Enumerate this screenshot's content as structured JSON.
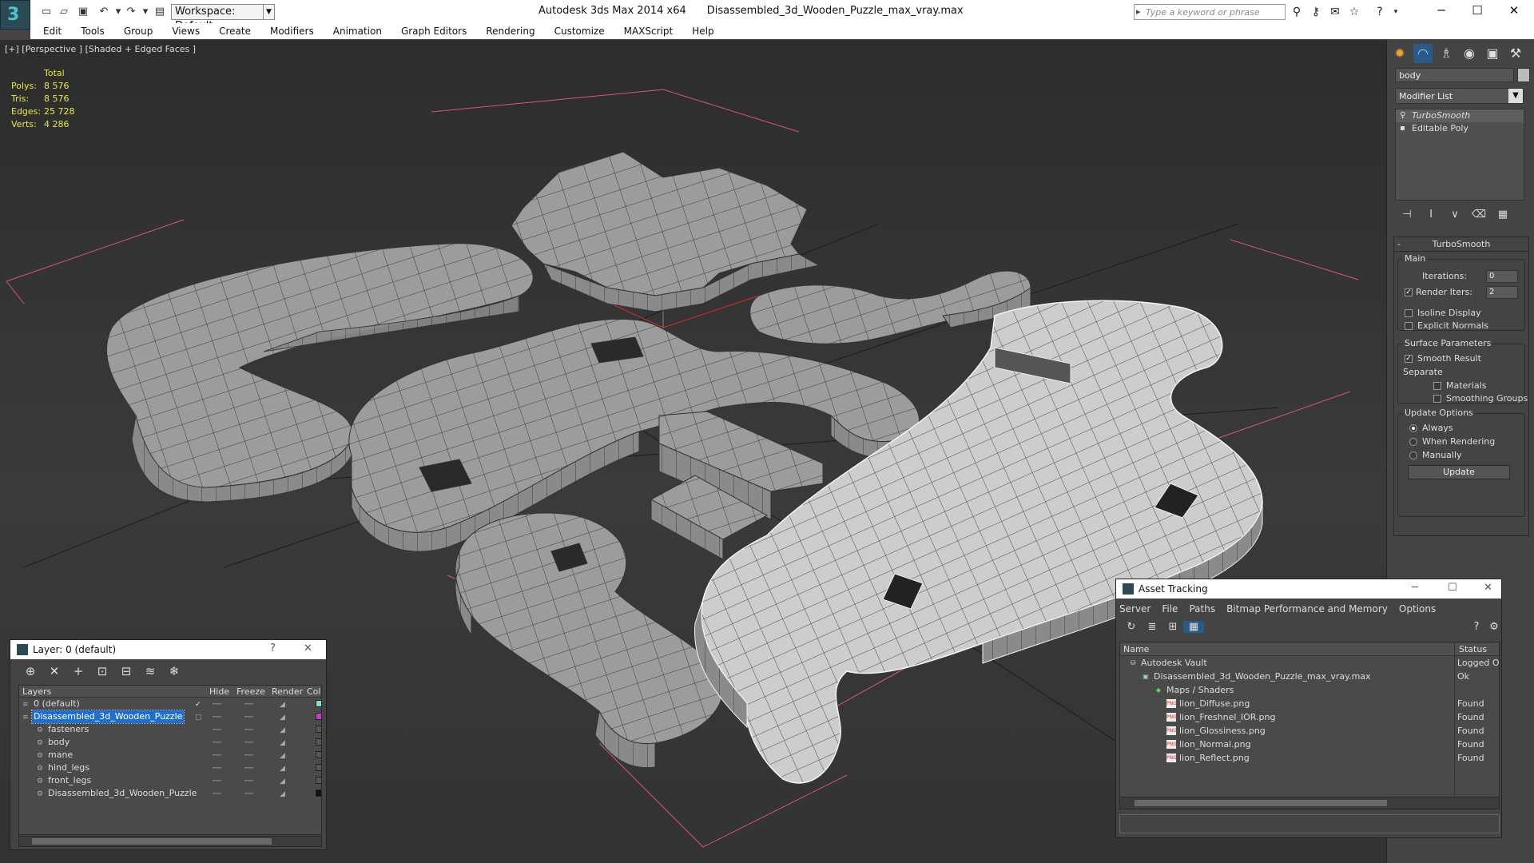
{
  "app": {
    "name": "Autodesk 3ds Max  2014 x64",
    "file": "Disassembled_3d_Wooden_Puzzle_max_vray.max",
    "workspace": "Workspace: Default",
    "search_placeholder": "Type a keyword or phrase"
  },
  "menu": [
    "Edit",
    "Tools",
    "Group",
    "Views",
    "Create",
    "Modifiers",
    "Animation",
    "Graph Editors",
    "Rendering",
    "Customize",
    "MAXScript",
    "Help"
  ],
  "viewport": {
    "label": "[+] [Perspective ] [Shaded + Edged Faces ]",
    "stats": {
      "header": "Total",
      "rows": [
        {
          "k": "Polys:",
          "v": "8 576"
        },
        {
          "k": "Tris:",
          "v": "8 576"
        },
        {
          "k": "Edges:",
          "v": "25 728"
        },
        {
          "k": "Verts:",
          "v": "4 286"
        }
      ]
    }
  },
  "command_panel": {
    "object_name": "body",
    "modifier_list": "Modifier List",
    "stack": [
      "TurboSmooth",
      "Editable Poly"
    ],
    "rollout": {
      "title": "TurboSmooth",
      "main": "Main",
      "iterations_label": "Iterations:",
      "iterations": "0",
      "render_iters_label": "Render Iters:",
      "render_iters": "2",
      "isoline": "Isoline Display",
      "explicit": "Explicit Normals",
      "surface": "Surface Parameters",
      "smooth_result": "Smooth Result",
      "separate": "Separate",
      "materials": "Materials",
      "smoothing_groups": "Smoothing Groups",
      "update_options": "Update Options",
      "always": "Always",
      "when_rendering": "When Rendering",
      "manually": "Manually",
      "update": "Update"
    }
  },
  "layer_panel": {
    "title": "Layer: 0 (default)",
    "help": "?",
    "columns": [
      "Layers",
      "Hide",
      "Freeze",
      "Render",
      "Col"
    ],
    "rows": [
      {
        "name": "0 (default)",
        "indent": 0,
        "sel": false,
        "swatch": "#7fe0d0"
      },
      {
        "name": "Disassembled_3d_Wooden_Puzzle",
        "indent": 0,
        "sel": true,
        "swatch": "#c040c0"
      },
      {
        "name": "fasteners",
        "indent": 1,
        "sel": false,
        "swatch": "#555555"
      },
      {
        "name": "body",
        "indent": 1,
        "sel": false,
        "swatch": "#555555"
      },
      {
        "name": "mane",
        "indent": 1,
        "sel": false,
        "swatch": "#555555"
      },
      {
        "name": "hind_legs",
        "indent": 1,
        "sel": false,
        "swatch": "#555555"
      },
      {
        "name": "front_legs",
        "indent": 1,
        "sel": false,
        "swatch": "#555555"
      },
      {
        "name": "Disassembled_3d_Wooden_Puzzle",
        "indent": 1,
        "sel": false,
        "swatch": "#111111"
      }
    ]
  },
  "asset_panel": {
    "title": "Asset Tracking",
    "menu": [
      "Server",
      "File",
      "Paths",
      "Bitmap Performance and Memory",
      "Options"
    ],
    "columns": [
      "Name",
      "Status"
    ],
    "rows": [
      {
        "name": "Autodesk Vault",
        "status": "Logged Ou",
        "indent": 0,
        "icon": "vault-icon"
      },
      {
        "name": "Disassembled_3d_Wooden_Puzzle_max_vray.max",
        "status": "Ok",
        "indent": 1,
        "icon": "max-file-icon"
      },
      {
        "name": "Maps / Shaders",
        "status": "",
        "indent": 2,
        "icon": "maps-icon"
      },
      {
        "name": "lion_Diffuse.png",
        "status": "Found",
        "indent": 3,
        "icon": "png-icon"
      },
      {
        "name": "lion_Freshnel_IOR.png",
        "status": "Found",
        "indent": 3,
        "icon": "png-icon"
      },
      {
        "name": "lion_Glossiness.png",
        "status": "Found",
        "indent": 3,
        "icon": "png-icon"
      },
      {
        "name": "lion_Normal.png",
        "status": "Found",
        "indent": 3,
        "icon": "png-icon"
      },
      {
        "name": "lion_Reflect.png",
        "status": "Found",
        "indent": 3,
        "icon": "png-icon"
      }
    ]
  },
  "colors": {
    "selection": "#1f6fd0",
    "stats_text": "#e6e84a",
    "mesh": "#9a9a9a",
    "mesh_edge": "#3a3a3a",
    "selected_mesh": "#c8c8c8",
    "grid_pink": "#d05a78"
  }
}
